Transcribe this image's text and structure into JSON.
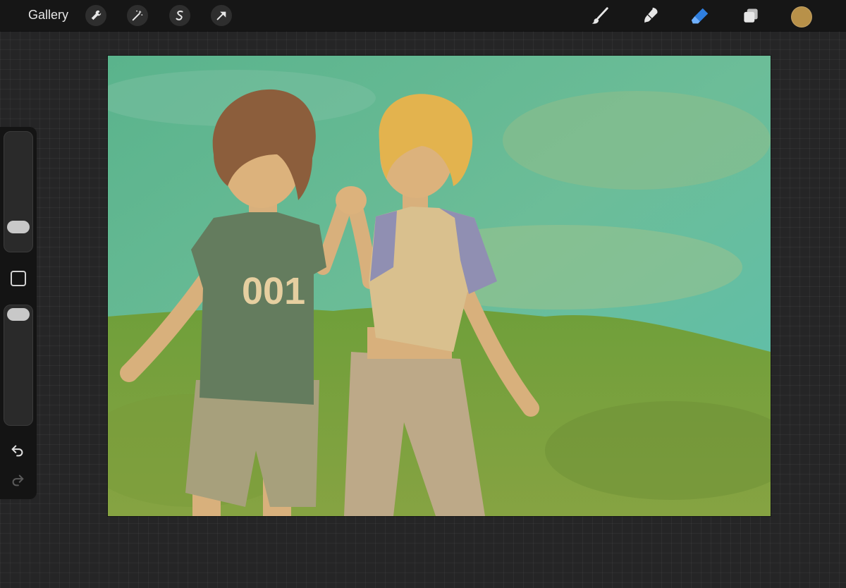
{
  "topbar": {
    "gallery_label": "Gallery",
    "left_tools": [
      "wrench-icon",
      "magic-wand-icon",
      "selection-icon",
      "transform-arrow-icon"
    ],
    "right_tools": [
      "brush-icon",
      "smudge-icon",
      "eraser-icon",
      "layers-icon"
    ],
    "active_tool": "eraser-icon",
    "current_color": "#b89149",
    "accent_color": "#2f7fe0"
  },
  "sidebar": {
    "brush_size_level": 0.75,
    "opacity_level": 0.0,
    "modify_button": "square-button",
    "undo": "undo-icon",
    "redo": "redo-icon"
  },
  "canvas": {
    "shirt_text": "001",
    "sky_color": "#5fba96",
    "grass_color": "#7ea53c"
  }
}
